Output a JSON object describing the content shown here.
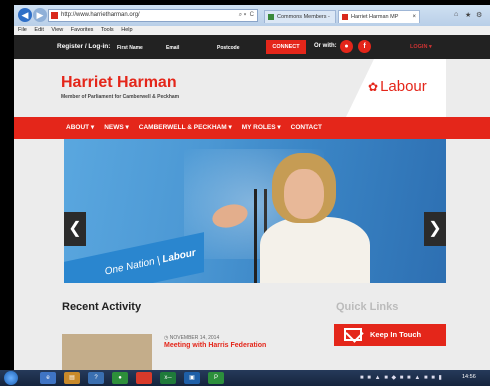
{
  "browser": {
    "url": "http://www.harrietharman.org/",
    "address_controls": "⌕ ▾  C",
    "menu": [
      "File",
      "Edit",
      "View",
      "Favorites",
      "Tools",
      "Help"
    ],
    "tabs": [
      {
        "label": "Commons Members - UK Parl..."
      },
      {
        "label": "Harriet Harman MP",
        "close": "×"
      }
    ],
    "window_controls": [
      "⌂",
      "★",
      "⚙"
    ]
  },
  "site": {
    "topbar": {
      "register_label": "Register / Log-in:",
      "fields": [
        "First Name",
        "Email",
        "Postcode"
      ],
      "connect_label": "CONNECT",
      "or_with_label": "Or with:",
      "login_label": "LOGIN ▾"
    },
    "name": "Harriet Harman",
    "tagline": "Member of Parliament for Camberwell & Peckham",
    "party_logo": "Labour",
    "nav": [
      "ABOUT ▾",
      "NEWS ▾",
      "CAMBERWELL & PECKHAM ▾",
      "MY ROLES ▾",
      "CONTACT"
    ],
    "hero": {
      "podium_text_1": "One Nation",
      "podium_text_2": "Labour",
      "prev_arrow": "❮",
      "next_arrow": "❯"
    },
    "recent_activity": {
      "heading": "Recent Activity",
      "item": {
        "date": "◷ NOVEMBER 14, 2014",
        "title": "Meeting with Harris Federation"
      }
    },
    "quick_links": {
      "heading": "Quick Links",
      "keep_in_touch": "Keep In Touch"
    }
  },
  "taskbar": {
    "items": [
      "e",
      "▤",
      "?",
      "●",
      "",
      "x─",
      "▣",
      "P"
    ],
    "tray_icons": "■ ■ ▲ ■ ◆ ■ ■ ▲ ■ ■ ▮",
    "clock": "14:56"
  }
}
